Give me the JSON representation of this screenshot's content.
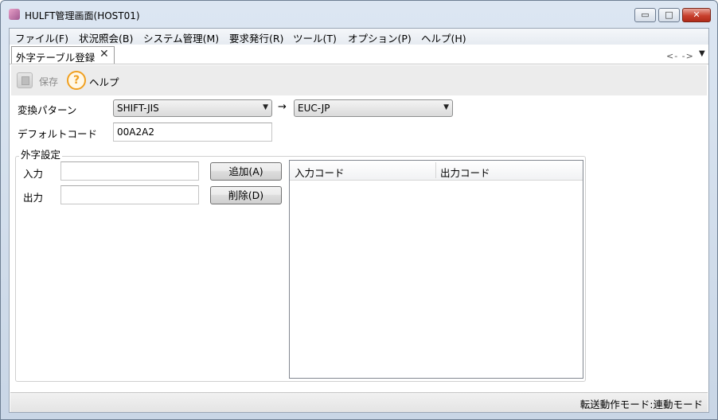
{
  "window": {
    "title": "HULFT管理画面(HOST01)",
    "controls": {
      "minimize": "▭",
      "maximize": "□",
      "close": "✕"
    }
  },
  "menu": [
    "ファイル(F)",
    "状況照会(B)",
    "システム管理(M)",
    "要求発行(R)",
    "ツール(T)",
    "オプション(P)",
    "ヘルプ(H)"
  ],
  "tab": {
    "label": "外字テーブル登録",
    "close": "✕"
  },
  "tab_nav": {
    "arrows": "<- ->",
    "overflow": "▼"
  },
  "toolbar": {
    "save": "保存",
    "help_icon_glyph": "?",
    "help": "ヘルプ"
  },
  "form": {
    "conversion_label": "変換パターン",
    "source_encoding": "SHIFT-JIS",
    "arrow": "→",
    "target_encoding": "EUC-JP",
    "default_code_label": "デフォルトコード",
    "default_code_value": "00A2A2",
    "combo_arrow": "▼"
  },
  "gaiji": {
    "group_title": "外字設定",
    "input_label": "入力",
    "output_label": "出力",
    "input_value": "",
    "output_value": "",
    "add_button": "追加(A)",
    "delete_button": "削除(D)",
    "table_headers": [
      "入力コード",
      "出力コード"
    ],
    "rows": []
  },
  "status": {
    "text": "転送動作モード:連動モード"
  }
}
